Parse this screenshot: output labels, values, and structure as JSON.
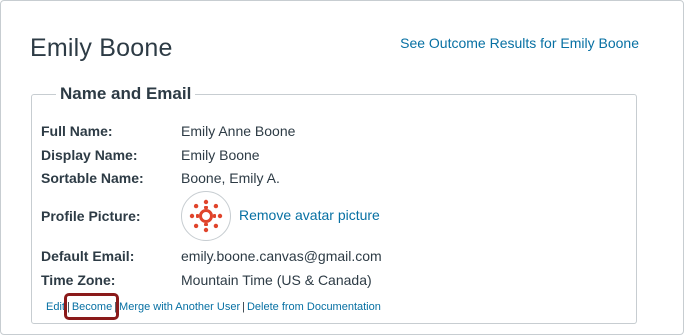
{
  "user": {
    "title": "Emily Boone",
    "outcome_link": "See Outcome Results for Emily Boone"
  },
  "section": {
    "legend": "Name and Email"
  },
  "fields": {
    "full_name": {
      "label": "Full Name:",
      "value": "Emily Anne Boone"
    },
    "display_name": {
      "label": "Display Name:",
      "value": "Emily Boone"
    },
    "sortable_name": {
      "label": "Sortable Name:",
      "value": "Boone, Emily A."
    },
    "profile_picture": {
      "label": "Profile Picture:",
      "remove_link": "Remove avatar picture"
    },
    "default_email": {
      "label": "Default Email:",
      "value": "emily.boone.canvas@gmail.com"
    },
    "time_zone": {
      "label": "Time Zone:",
      "value": "Mountain Time (US & Canada)"
    }
  },
  "actions": {
    "edit": "Edit",
    "become": "Become",
    "merge": "Merge with Another User",
    "separator": "|",
    "delete": "Delete from Documentation"
  },
  "colors": {
    "link": "#0770a3",
    "text": "#2d3b45",
    "highlight": "#8a1a1a",
    "avatar_red": "#e0442b"
  },
  "icons": {
    "avatar": "canvas-logo-icon"
  }
}
